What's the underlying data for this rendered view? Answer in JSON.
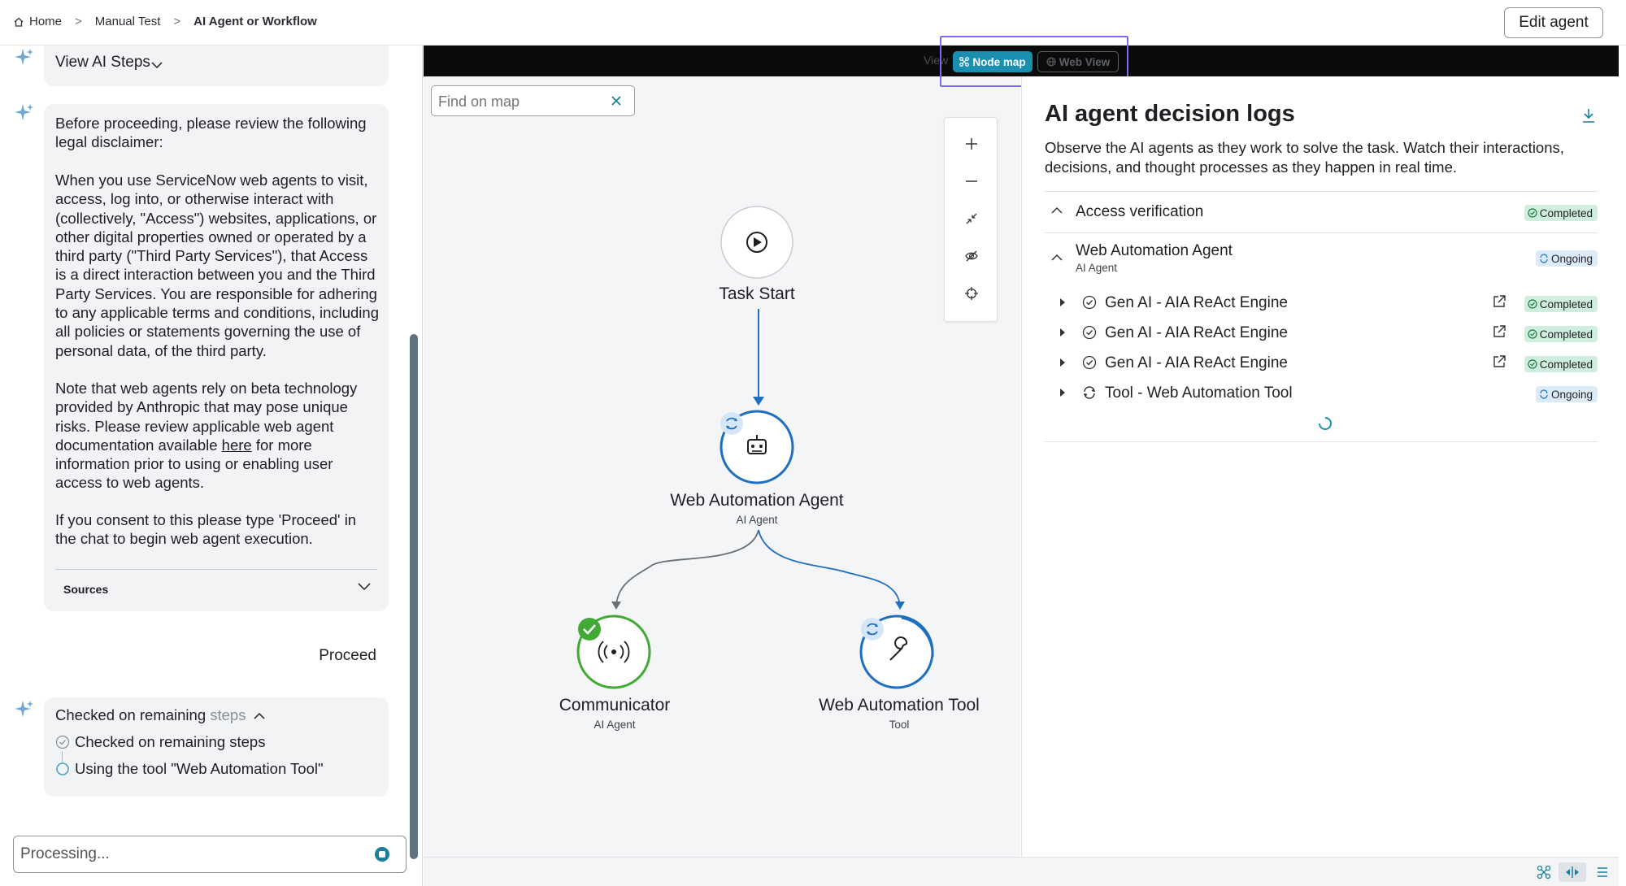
{
  "breadcrumbs": [
    "Home",
    "Manual Test",
    "AI Agent or Workflow"
  ],
  "edit_agent_label": "Edit agent",
  "chat": {
    "view_steps": "View AI Steps",
    "disclaimer_p1": "Before proceeding, please review the following legal disclaimer:",
    "disclaimer_p2": "When you use ServiceNow web agents to visit, access, log into, or otherwise interact with (collectively, \"Access\") websites, applications, or other digital properties owned or operated by a third party (\"Third Party Services\"), that Access is a direct interaction between you and the Third Party Services. You are responsible for adhering to any applicable terms and conditions, including all policies or statements governing the use of personal data, of the third party.",
    "disclaimer_p3_a": "Note that web agents rely on beta technology provided by Anthropic that may pose unique risks. Please review applicable web agent documentation available ",
    "disclaimer_p3_link": "here",
    "disclaimer_p3_b": " for more information prior to using or enabling user access to web agents.",
    "disclaimer_p4": "If you consent to this please type 'Proceed' in the chat to begin web agent execution.",
    "sources_label": "Sources",
    "user_message": "Proceed",
    "checked_head_a": "Checked on remaining",
    "checked_head_b": "steps",
    "step1": "Checked on remaining steps",
    "step2": "Using the tool \"Web Automation Tool\"",
    "input_value": "Processing..."
  },
  "map": {
    "view_label": "View",
    "node_map_label": "Node map",
    "web_view_label": "Web View",
    "find_placeholder": "Find on map",
    "nodes": {
      "task_start": "Task Start",
      "web_agent": "Web Automation Agent",
      "web_agent_sub": "AI Agent",
      "communicator": "Communicator",
      "communicator_sub": "AI Agent",
      "tool": "Web Automation Tool",
      "tool_sub": "Tool"
    }
  },
  "logs": {
    "title": "AI agent decision logs",
    "description": "Observe the AI agents as they work to solve the task. Watch their interactions, decisions, and thought processes as they happen in real time.",
    "access_verification": "Access verification",
    "web_agent": "Web Automation Agent",
    "web_agent_sub": "AI Agent",
    "steps": [
      {
        "label": "Gen AI - AIA ReAct Engine",
        "status": "Completed"
      },
      {
        "label": "Gen AI - AIA ReAct Engine",
        "status": "Completed"
      },
      {
        "label": "Gen AI - AIA ReAct Engine",
        "status": "Completed"
      },
      {
        "label": "Tool - Web Automation Tool",
        "status": "Ongoing"
      }
    ],
    "status_completed": "Completed",
    "status_ongoing": "Ongoing"
  },
  "colors": {
    "accent": "#1a8fb0",
    "agent_blue": "#1f6fbf",
    "success_green": "#43a935",
    "highlight_purple": "#7b6df0"
  }
}
